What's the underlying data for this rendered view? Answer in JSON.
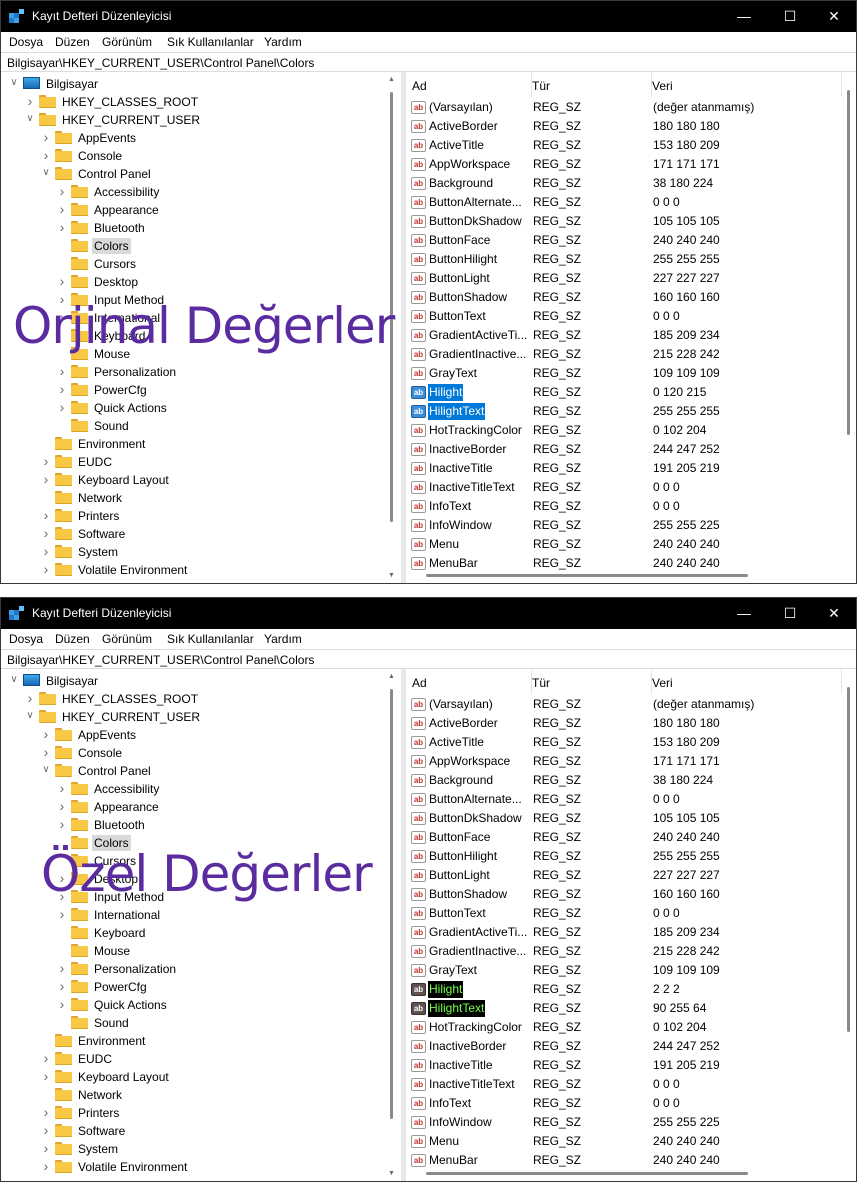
{
  "app": {
    "title": "Kayıt Defteri Düzenleyicisi",
    "menu": [
      "Dosya",
      "Düzen",
      "Görünüm",
      "Sık Kullanılanlar",
      "Yardım"
    ],
    "address": "Bilgisayar\\HKEY_CURRENT_USER\\Control Panel\\Colors",
    "columns": {
      "name": "Ad",
      "type": "Tür",
      "data": "Veri"
    }
  },
  "tree": [
    {
      "label": "Bilgisayar",
      "depth": 0,
      "expanded": true,
      "kind": "pc"
    },
    {
      "label": "HKEY_CLASSES_ROOT",
      "depth": 1,
      "expanded": false
    },
    {
      "label": "HKEY_CURRENT_USER",
      "depth": 1,
      "expanded": true
    },
    {
      "label": "AppEvents",
      "depth": 2,
      "expanded": false
    },
    {
      "label": "Console",
      "depth": 2,
      "expanded": false
    },
    {
      "label": "Control Panel",
      "depth": 2,
      "expanded": true
    },
    {
      "label": "Accessibility",
      "depth": 3,
      "expanded": false
    },
    {
      "label": "Appearance",
      "depth": 3,
      "expanded": false
    },
    {
      "label": "Bluetooth",
      "depth": 3,
      "expanded": false
    },
    {
      "label": "Colors",
      "depth": 3,
      "leaf": true,
      "selected": true
    },
    {
      "label": "Cursors",
      "depth": 3,
      "leaf": true
    },
    {
      "label": "Desktop",
      "depth": 3,
      "expanded": false
    },
    {
      "label": "Input Method",
      "depth": 3,
      "expanded": false
    },
    {
      "label": "International",
      "depth": 3,
      "expanded": false
    },
    {
      "label": "Keyboard",
      "depth": 3,
      "leaf": true
    },
    {
      "label": "Mouse",
      "depth": 3,
      "leaf": true
    },
    {
      "label": "Personalization",
      "depth": 3,
      "expanded": false
    },
    {
      "label": "PowerCfg",
      "depth": 3,
      "expanded": false
    },
    {
      "label": "Quick Actions",
      "depth": 3,
      "expanded": false
    },
    {
      "label": "Sound",
      "depth": 3,
      "leaf": true
    },
    {
      "label": "Environment",
      "depth": 2,
      "leaf": true
    },
    {
      "label": "EUDC",
      "depth": 2,
      "expanded": false
    },
    {
      "label": "Keyboard Layout",
      "depth": 2,
      "expanded": false
    },
    {
      "label": "Network",
      "depth": 2,
      "leaf": true
    },
    {
      "label": "Printers",
      "depth": 2,
      "expanded": false
    },
    {
      "label": "Software",
      "depth": 2,
      "expanded": false
    },
    {
      "label": "System",
      "depth": 2,
      "expanded": false
    },
    {
      "label": "Volatile Environment",
      "depth": 2,
      "expanded": false
    }
  ],
  "windows": [
    {
      "overlay_text": "Orjinal Değerler",
      "selection_style": "blue",
      "values": [
        {
          "name": "(Varsayılan)",
          "type": "REG_SZ",
          "data": "(değer atanmamış)"
        },
        {
          "name": "ActiveBorder",
          "type": "REG_SZ",
          "data": "180 180 180"
        },
        {
          "name": "ActiveTitle",
          "type": "REG_SZ",
          "data": "153 180 209"
        },
        {
          "name": "AppWorkspace",
          "type": "REG_SZ",
          "data": "171 171 171"
        },
        {
          "name": "Background",
          "type": "REG_SZ",
          "data": "38 180 224"
        },
        {
          "name": "ButtonAlternate...",
          "type": "REG_SZ",
          "data": "0 0 0"
        },
        {
          "name": "ButtonDkShadow",
          "type": "REG_SZ",
          "data": "105 105 105"
        },
        {
          "name": "ButtonFace",
          "type": "REG_SZ",
          "data": "240 240 240"
        },
        {
          "name": "ButtonHilight",
          "type": "REG_SZ",
          "data": "255 255 255"
        },
        {
          "name": "ButtonLight",
          "type": "REG_SZ",
          "data": "227 227 227"
        },
        {
          "name": "ButtonShadow",
          "type": "REG_SZ",
          "data": "160 160 160"
        },
        {
          "name": "ButtonText",
          "type": "REG_SZ",
          "data": "0 0 0"
        },
        {
          "name": "GradientActiveTi...",
          "type": "REG_SZ",
          "data": "185 209 234"
        },
        {
          "name": "GradientInactive...",
          "type": "REG_SZ",
          "data": "215 228 242"
        },
        {
          "name": "GrayText",
          "type": "REG_SZ",
          "data": "109 109 109"
        },
        {
          "name": "Hilight",
          "type": "REG_SZ",
          "data": "0 120 215",
          "selected": true
        },
        {
          "name": "HilightText",
          "type": "REG_SZ",
          "data": "255 255 255",
          "selected": true
        },
        {
          "name": "HotTrackingColor",
          "type": "REG_SZ",
          "data": "0 102 204"
        },
        {
          "name": "InactiveBorder",
          "type": "REG_SZ",
          "data": "244 247 252"
        },
        {
          "name": "InactiveTitle",
          "type": "REG_SZ",
          "data": "191 205 219"
        },
        {
          "name": "InactiveTitleText",
          "type": "REG_SZ",
          "data": "0 0 0"
        },
        {
          "name": "InfoText",
          "type": "REG_SZ",
          "data": "0 0 0"
        },
        {
          "name": "InfoWindow",
          "type": "REG_SZ",
          "data": "255 255 225"
        },
        {
          "name": "Menu",
          "type": "REG_SZ",
          "data": "240 240 240"
        },
        {
          "name": "MenuBar",
          "type": "REG_SZ",
          "data": "240 240 240"
        }
      ]
    },
    {
      "overlay_text": "Özel Değerler",
      "selection_style": "custom",
      "values": [
        {
          "name": "(Varsayılan)",
          "type": "REG_SZ",
          "data": "(değer atanmamış)"
        },
        {
          "name": "ActiveBorder",
          "type": "REG_SZ",
          "data": "180 180 180"
        },
        {
          "name": "ActiveTitle",
          "type": "REG_SZ",
          "data": "153 180 209"
        },
        {
          "name": "AppWorkspace",
          "type": "REG_SZ",
          "data": "171 171 171"
        },
        {
          "name": "Background",
          "type": "REG_SZ",
          "data": "38 180 224"
        },
        {
          "name": "ButtonAlternate...",
          "type": "REG_SZ",
          "data": "0 0 0"
        },
        {
          "name": "ButtonDkShadow",
          "type": "REG_SZ",
          "data": "105 105 105"
        },
        {
          "name": "ButtonFace",
          "type": "REG_SZ",
          "data": "240 240 240"
        },
        {
          "name": "ButtonHilight",
          "type": "REG_SZ",
          "data": "255 255 255"
        },
        {
          "name": "ButtonLight",
          "type": "REG_SZ",
          "data": "227 227 227"
        },
        {
          "name": "ButtonShadow",
          "type": "REG_SZ",
          "data": "160 160 160"
        },
        {
          "name": "ButtonText",
          "type": "REG_SZ",
          "data": "0 0 0"
        },
        {
          "name": "GradientActiveTi...",
          "type": "REG_SZ",
          "data": "185 209 234"
        },
        {
          "name": "GradientInactive...",
          "type": "REG_SZ",
          "data": "215 228 242"
        },
        {
          "name": "GrayText",
          "type": "REG_SZ",
          "data": "109 109 109"
        },
        {
          "name": "Hilight",
          "type": "REG_SZ",
          "data": "2 2 2",
          "selected": true
        },
        {
          "name": "HilightText",
          "type": "REG_SZ",
          "data": "90 255 64",
          "selected": true
        },
        {
          "name": "HotTrackingColor",
          "type": "REG_SZ",
          "data": "0 102 204"
        },
        {
          "name": "InactiveBorder",
          "type": "REG_SZ",
          "data": "244 247 252"
        },
        {
          "name": "InactiveTitle",
          "type": "REG_SZ",
          "data": "191 205 219"
        },
        {
          "name": "InactiveTitleText",
          "type": "REG_SZ",
          "data": "0 0 0"
        },
        {
          "name": "InfoText",
          "type": "REG_SZ",
          "data": "0 0 0"
        },
        {
          "name": "InfoWindow",
          "type": "REG_SZ",
          "data": "255 255 225"
        },
        {
          "name": "Menu",
          "type": "REG_SZ",
          "data": "240 240 240"
        },
        {
          "name": "MenuBar",
          "type": "REG_SZ",
          "data": "240 240 240"
        }
      ]
    }
  ],
  "colors": {
    "accent": "#0078d7",
    "custom_highlight_bg": "#000000",
    "custom_highlight_text": "#76ff4a",
    "overlay": "#5b2ca0"
  }
}
